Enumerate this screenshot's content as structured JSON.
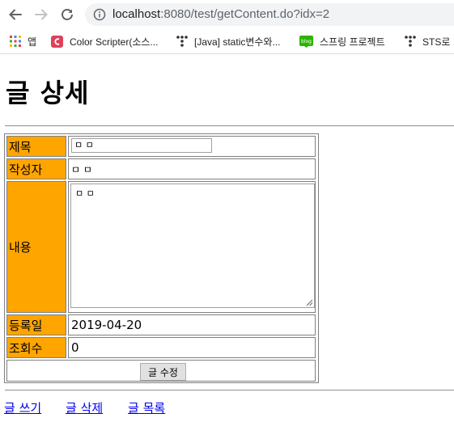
{
  "browser": {
    "url_host": "localhost",
    "url_rest": ":8080/test/getContent.do?idx=2",
    "bookmarks": [
      {
        "label": "앱"
      },
      {
        "label": "Color Scripter(소스..."
      },
      {
        "label": "[Java] static변수와..."
      },
      {
        "label": "스프링 프로젝트"
      },
      {
        "label": "STS로 ..."
      }
    ]
  },
  "page": {
    "title": "글 상세",
    "fields": {
      "title_label": "제목",
      "title_value": "ㅁ ㅁ",
      "writer_label": "작성자",
      "writer_value": "ㅁ ㅁ",
      "content_label": "내용",
      "content_value": "ㅁ ㅁ",
      "regdate_label": "등록일",
      "regdate_value": "2019-04-20",
      "views_label": "조회수",
      "views_value": "0"
    },
    "update_button": "글 수정",
    "links": {
      "write": "글 쓰기",
      "delete": "글 삭제",
      "list": "글 목록"
    }
  },
  "colors": {
    "label_bg": "#ffa500",
    "link": "#0000ee"
  }
}
